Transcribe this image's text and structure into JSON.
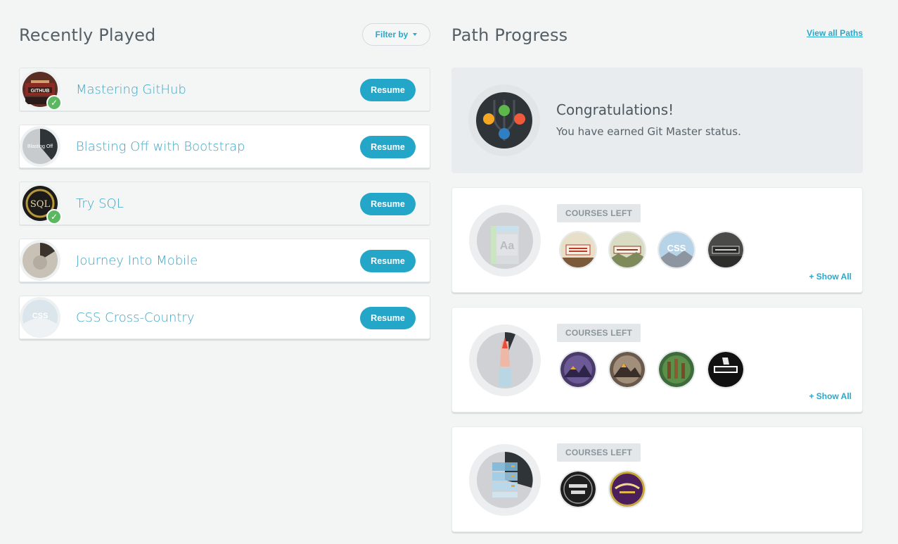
{
  "recently_played": {
    "title": "Recently Played",
    "filter_label": "Filter by",
    "resume_label": "Resume",
    "courses": [
      {
        "title": "Mastering GitHub",
        "completed": true,
        "badge_text": "GITHUB"
      },
      {
        "title": "Blasting Off with Bootstrap",
        "completed": false,
        "badge_text": "Blasting Off"
      },
      {
        "title": "Try SQL",
        "completed": true,
        "badge_text": "SQL"
      },
      {
        "title": "Journey Into Mobile",
        "completed": false
      },
      {
        "title": "CSS Cross-Country",
        "completed": false,
        "badge_text": "CSS"
      }
    ]
  },
  "path_progress": {
    "title": "Path Progress",
    "view_all_label": "View all Paths",
    "congrats": {
      "heading": "Congratulations!",
      "message": "You have earned Git Master status."
    },
    "courses_left_label": "COURSES LEFT",
    "show_all_label": "+ Show All",
    "paths": [
      {
        "name": "html-css-path",
        "badges": [
          "front-end-foundations-badge",
          "front-end-formations-badge",
          "css-cross-country-badge",
          "adventures-badge"
        ],
        "show_all": true
      },
      {
        "name": "javascript-path",
        "badges": [
          "javascript-road-trip-1-badge",
          "javascript-road-trip-2-badge",
          "javascript-road-trip-3-badge",
          "javascript-best-practices-badge"
        ],
        "show_all": true
      },
      {
        "name": "database-path",
        "badges": [
          "the-sequel-to-sql-badge",
          "the-magical-mysteries-badge"
        ],
        "show_all": false
      }
    ]
  },
  "colors": {
    "accent": "#24a6c9",
    "link": "#2aa7c9",
    "check": "#5cb860",
    "background": "#f3f5f4"
  }
}
